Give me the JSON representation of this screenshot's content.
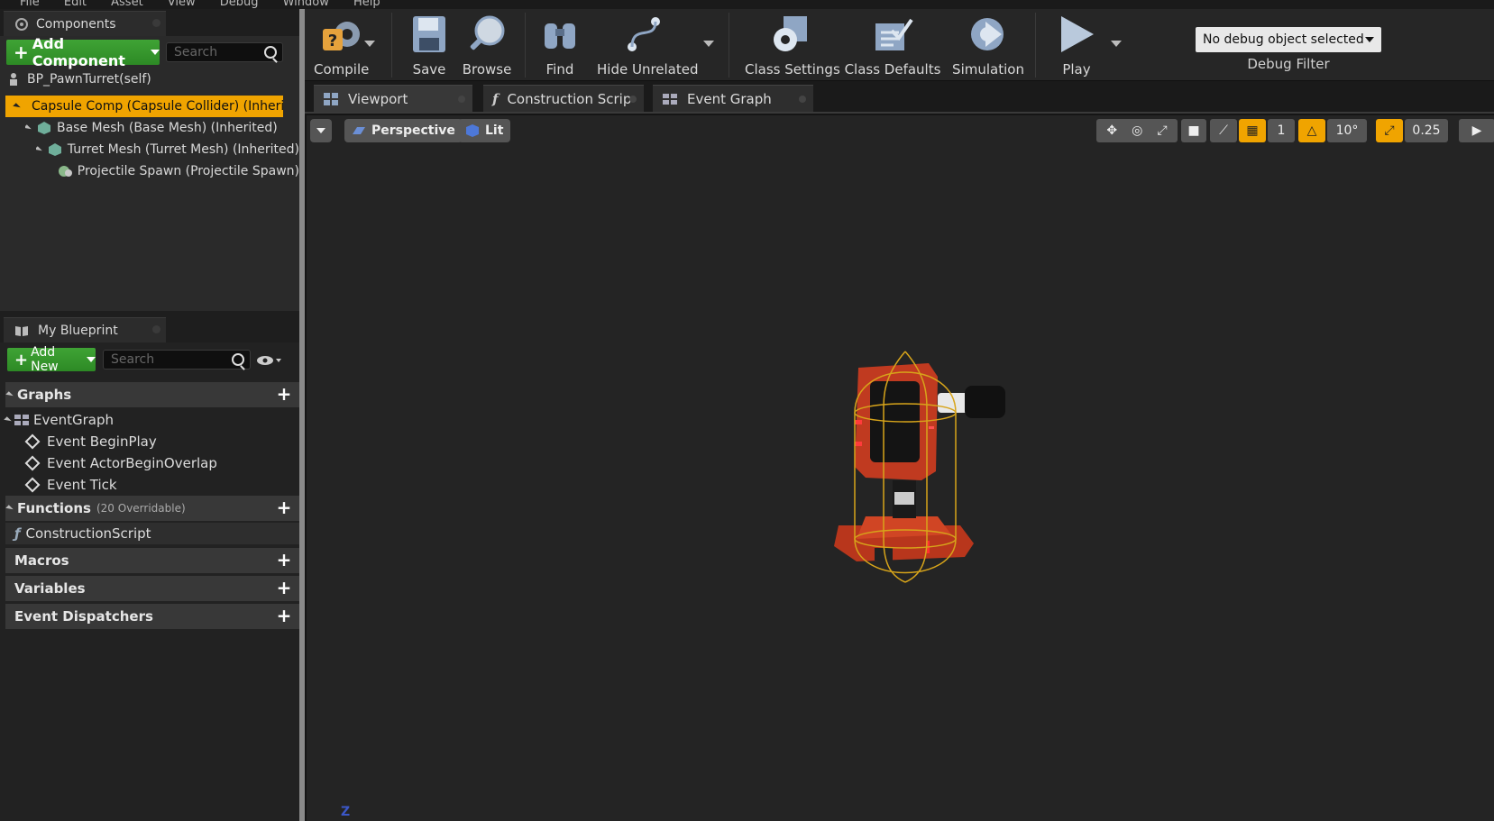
{
  "menu": [
    "File",
    "Edit",
    "Asset",
    "View",
    "Debug",
    "Window",
    "Help"
  ],
  "components_panel": {
    "title": "Components",
    "add_button": "Add Component",
    "search_placeholder": "Search",
    "root": "BP_PawnTurret(self)",
    "tree": [
      {
        "label": "Capsule Comp (Capsule Collider) (Inherit",
        "selected": true
      },
      {
        "label": "Base Mesh (Base Mesh) (Inherited)"
      },
      {
        "label": "Turret Mesh (Turret Mesh) (Inherited)"
      },
      {
        "label": "Projectile Spawn (Projectile Spawn)"
      }
    ]
  },
  "my_blueprint": {
    "title": "My Blueprint",
    "add_button": "Add New",
    "search_placeholder": "Search",
    "graphs": {
      "label": "Graphs",
      "items": [
        "EventGraph"
      ],
      "events": [
        "Event BeginPlay",
        "Event ActorBeginOverlap",
        "Event Tick"
      ]
    },
    "functions": {
      "label": "Functions",
      "count": "(20 Overridable)",
      "items": [
        "ConstructionScript"
      ]
    },
    "macros": "Macros",
    "variables": "Variables",
    "dispatchers": "Event Dispatchers"
  },
  "toolbar": {
    "compile": "Compile",
    "save": "Save",
    "browse": "Browse",
    "find": "Find",
    "hide_unrelated": "Hide Unrelated",
    "class_settings": "Class Settings",
    "class_defaults": "Class Defaults",
    "simulation": "Simulation",
    "play": "Play",
    "debug_object": "No debug object selected",
    "debug_filter": "Debug Filter"
  },
  "tabs": [
    "Viewport",
    "Construction Scrip",
    "Event Graph"
  ],
  "viewport": {
    "perspective": "Perspective",
    "lit": "Lit",
    "grid_snap": "1",
    "rotation_snap": "10°",
    "scale_snap": "0.25",
    "axis": "Z"
  },
  "colors": {
    "accent_orange": "#f0a400",
    "green": "#2e8b25",
    "selection": "#f0a400"
  }
}
